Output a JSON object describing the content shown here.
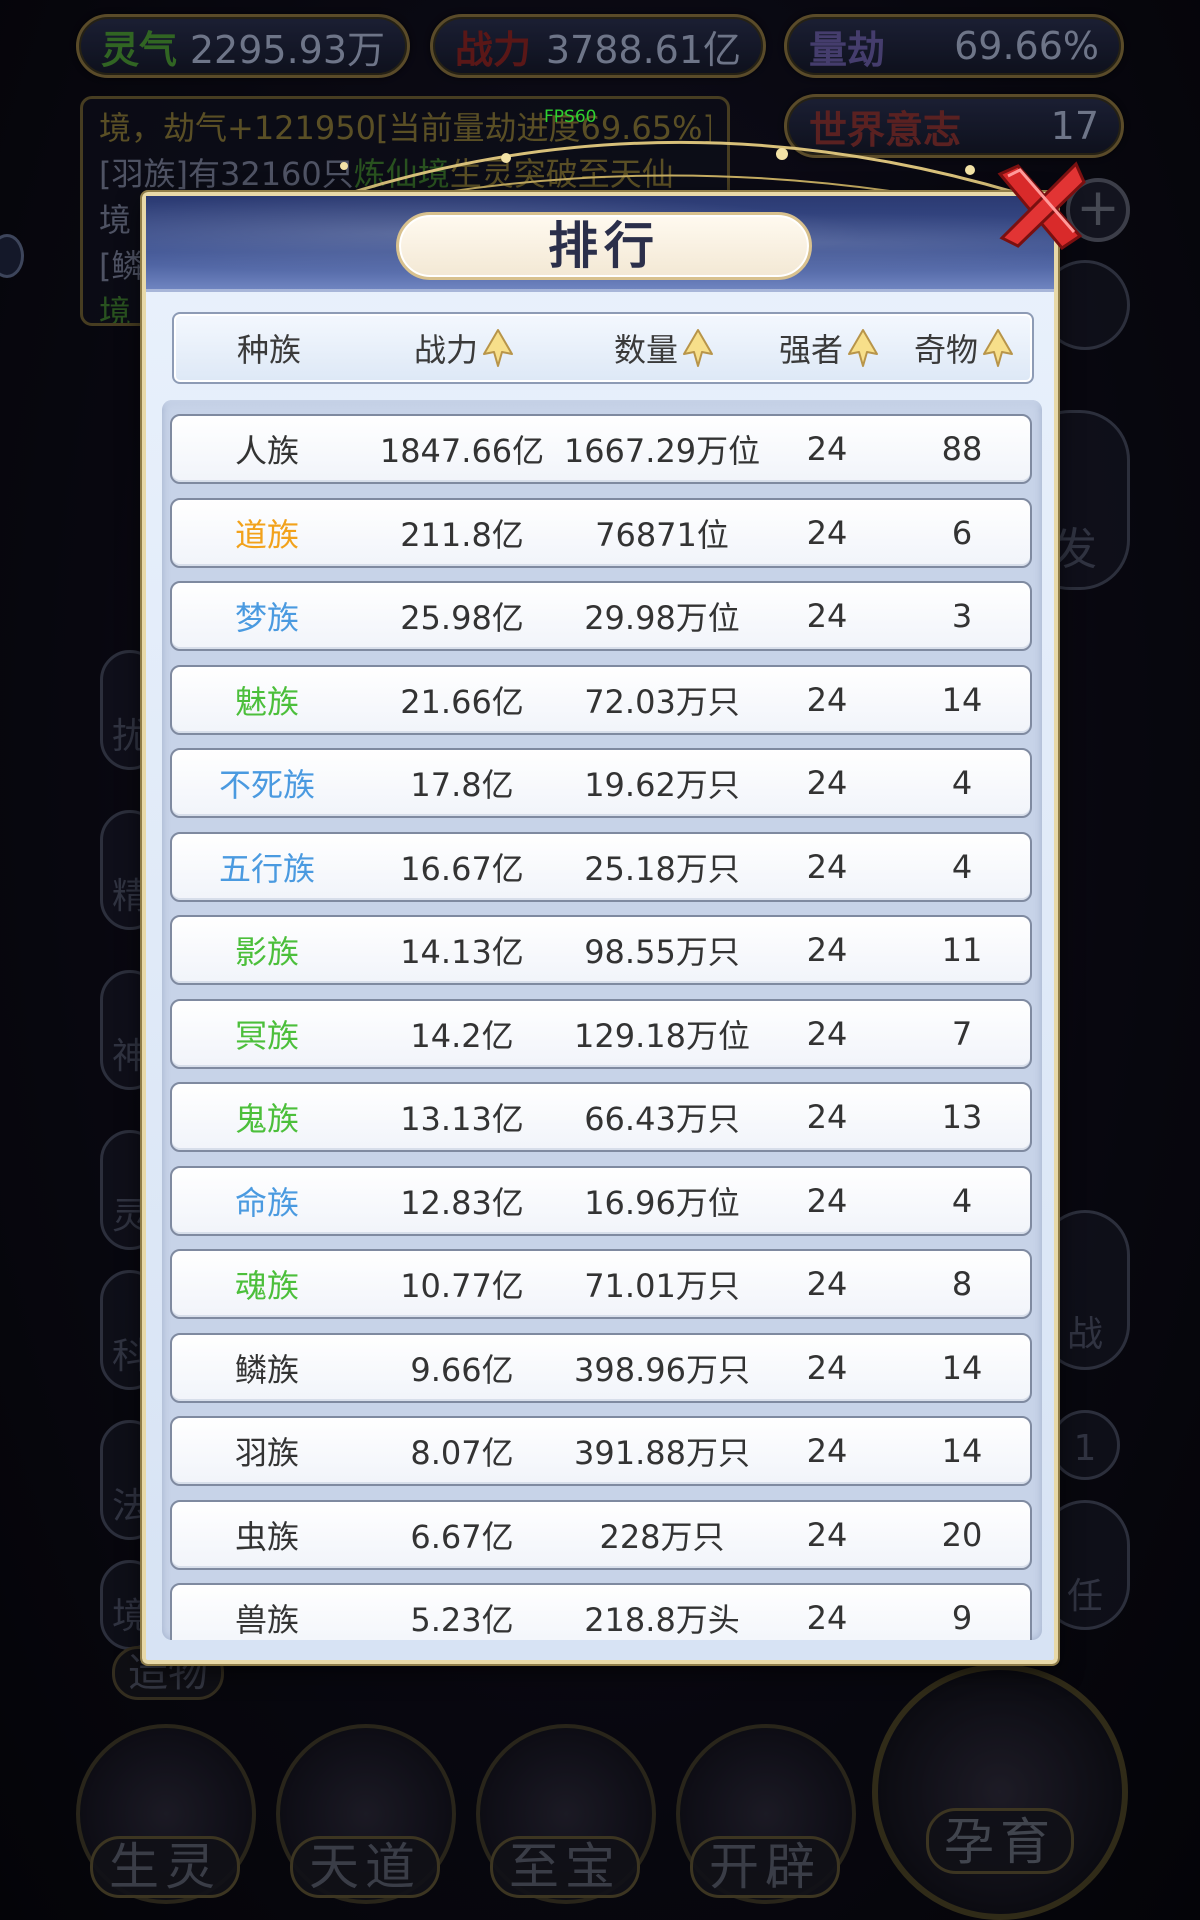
{
  "hud": {
    "lingqi_label": "灵气",
    "lingqi_value": "2295.93万",
    "zhanli_label": "战力",
    "zhanli_value": "3788.61亿",
    "liangjie_label": "量劫",
    "liangjie_value": "69.66%",
    "shijie_label": "世界意志",
    "shijie_value": "17"
  },
  "fps": "FPS60",
  "log": {
    "line1": "境，劫气+121950[当前量劫进度69.65%]",
    "line2_a": "[羽族]有32160只",
    "line2_b": "炼仙境",
    "line2_c": "生灵突破至天仙",
    "line3": "境",
    "line4": "[鳞",
    "line5": "境"
  },
  "side_tags": {
    "right_fa": "发",
    "right_zhan": "战",
    "right_one": "1",
    "right_ren": "任",
    "left_ba": "扰",
    "left_jing": "精",
    "left_shen": "神",
    "left_ling": "灵",
    "left_ke": "科",
    "left_fa": "法",
    "left_jing2": "境",
    "zaowu": "造物"
  },
  "bottom_nav": {
    "shengling": "生灵",
    "tiandao": "天道",
    "zhibao": "至宝",
    "kaipi": "开辟",
    "yunyu": "孕育"
  },
  "modal": {
    "title": "排行",
    "close_label": "关闭",
    "columns": {
      "race": "种族",
      "power": "战力",
      "count": "数量",
      "strong": "强者",
      "treasure": "奇物"
    },
    "colors": {
      "white": "#333333",
      "orange": "#f2a21b",
      "blue": "#4a9ae0",
      "green": "#4cbf3b"
    },
    "rows": [
      {
        "race": "人族",
        "power": "1847.66亿",
        "count": "1667.29万位",
        "strong": "24",
        "treasure": "88",
        "color": "#333333"
      },
      {
        "race": "道族",
        "power": "211.8亿",
        "count": "76871位",
        "strong": "24",
        "treasure": "6",
        "color": "#f2a21b"
      },
      {
        "race": "梦族",
        "power": "25.98亿",
        "count": "29.98万位",
        "strong": "24",
        "treasure": "3",
        "color": "#4a9ae0"
      },
      {
        "race": "魅族",
        "power": "21.66亿",
        "count": "72.03万只",
        "strong": "24",
        "treasure": "14",
        "color": "#4cbf3b"
      },
      {
        "race": "不死族",
        "power": "17.8亿",
        "count": "19.62万只",
        "strong": "24",
        "treasure": "4",
        "color": "#4a9ae0"
      },
      {
        "race": "五行族",
        "power": "16.67亿",
        "count": "25.18万只",
        "strong": "24",
        "treasure": "4",
        "color": "#4a9ae0"
      },
      {
        "race": "影族",
        "power": "14.13亿",
        "count": "98.55万只",
        "strong": "24",
        "treasure": "11",
        "color": "#4cbf3b"
      },
      {
        "race": "冥族",
        "power": "14.2亿",
        "count": "129.18万位",
        "strong": "24",
        "treasure": "7",
        "color": "#4cbf3b"
      },
      {
        "race": "鬼族",
        "power": "13.13亿",
        "count": "66.43万只",
        "strong": "24",
        "treasure": "13",
        "color": "#4cbf3b"
      },
      {
        "race": "命族",
        "power": "12.83亿",
        "count": "16.96万位",
        "strong": "24",
        "treasure": "4",
        "color": "#4a9ae0"
      },
      {
        "race": "魂族",
        "power": "10.77亿",
        "count": "71.01万只",
        "strong": "24",
        "treasure": "8",
        "color": "#4cbf3b"
      },
      {
        "race": "鳞族",
        "power": "9.66亿",
        "count": "398.96万只",
        "strong": "24",
        "treasure": "14",
        "color": "#333333"
      },
      {
        "race": "羽族",
        "power": "8.07亿",
        "count": "391.88万只",
        "strong": "24",
        "treasure": "14",
        "color": "#333333"
      },
      {
        "race": "虫族",
        "power": "6.67亿",
        "count": "228万只",
        "strong": "24",
        "treasure": "20",
        "color": "#333333"
      },
      {
        "race": "兽族",
        "power": "5.23亿",
        "count": "218.8万头",
        "strong": "24",
        "treasure": "9",
        "color": "#333333"
      }
    ]
  }
}
